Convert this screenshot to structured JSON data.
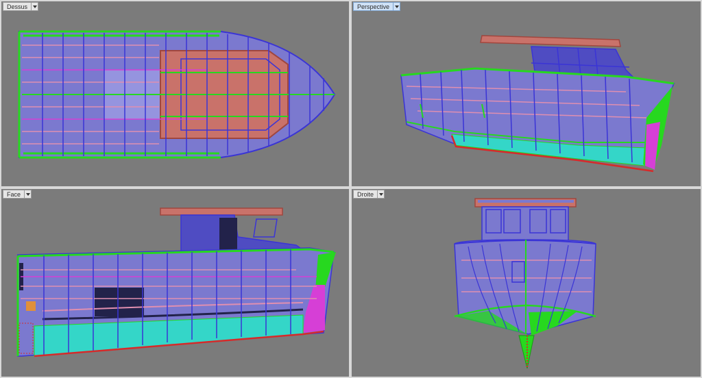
{
  "viewports": [
    {
      "id": "top",
      "label": "Dessus"
    },
    {
      "id": "perspective",
      "label": "Perspective"
    },
    {
      "id": "front",
      "label": "Face"
    },
    {
      "id": "right",
      "label": "Droite"
    }
  ],
  "colors": {
    "background": "#7b7b7b",
    "hull": "#7b79cf",
    "hull_edges": "#3a34d6",
    "deck_edge": "#27d81f",
    "cabin_roof": "#c9726a",
    "frames_pink": "#e08fb0",
    "magenta": "#d63fd6",
    "cyan": "#34d6c8",
    "keel_red": "#d62a2a",
    "window_dark": "#22224a"
  }
}
